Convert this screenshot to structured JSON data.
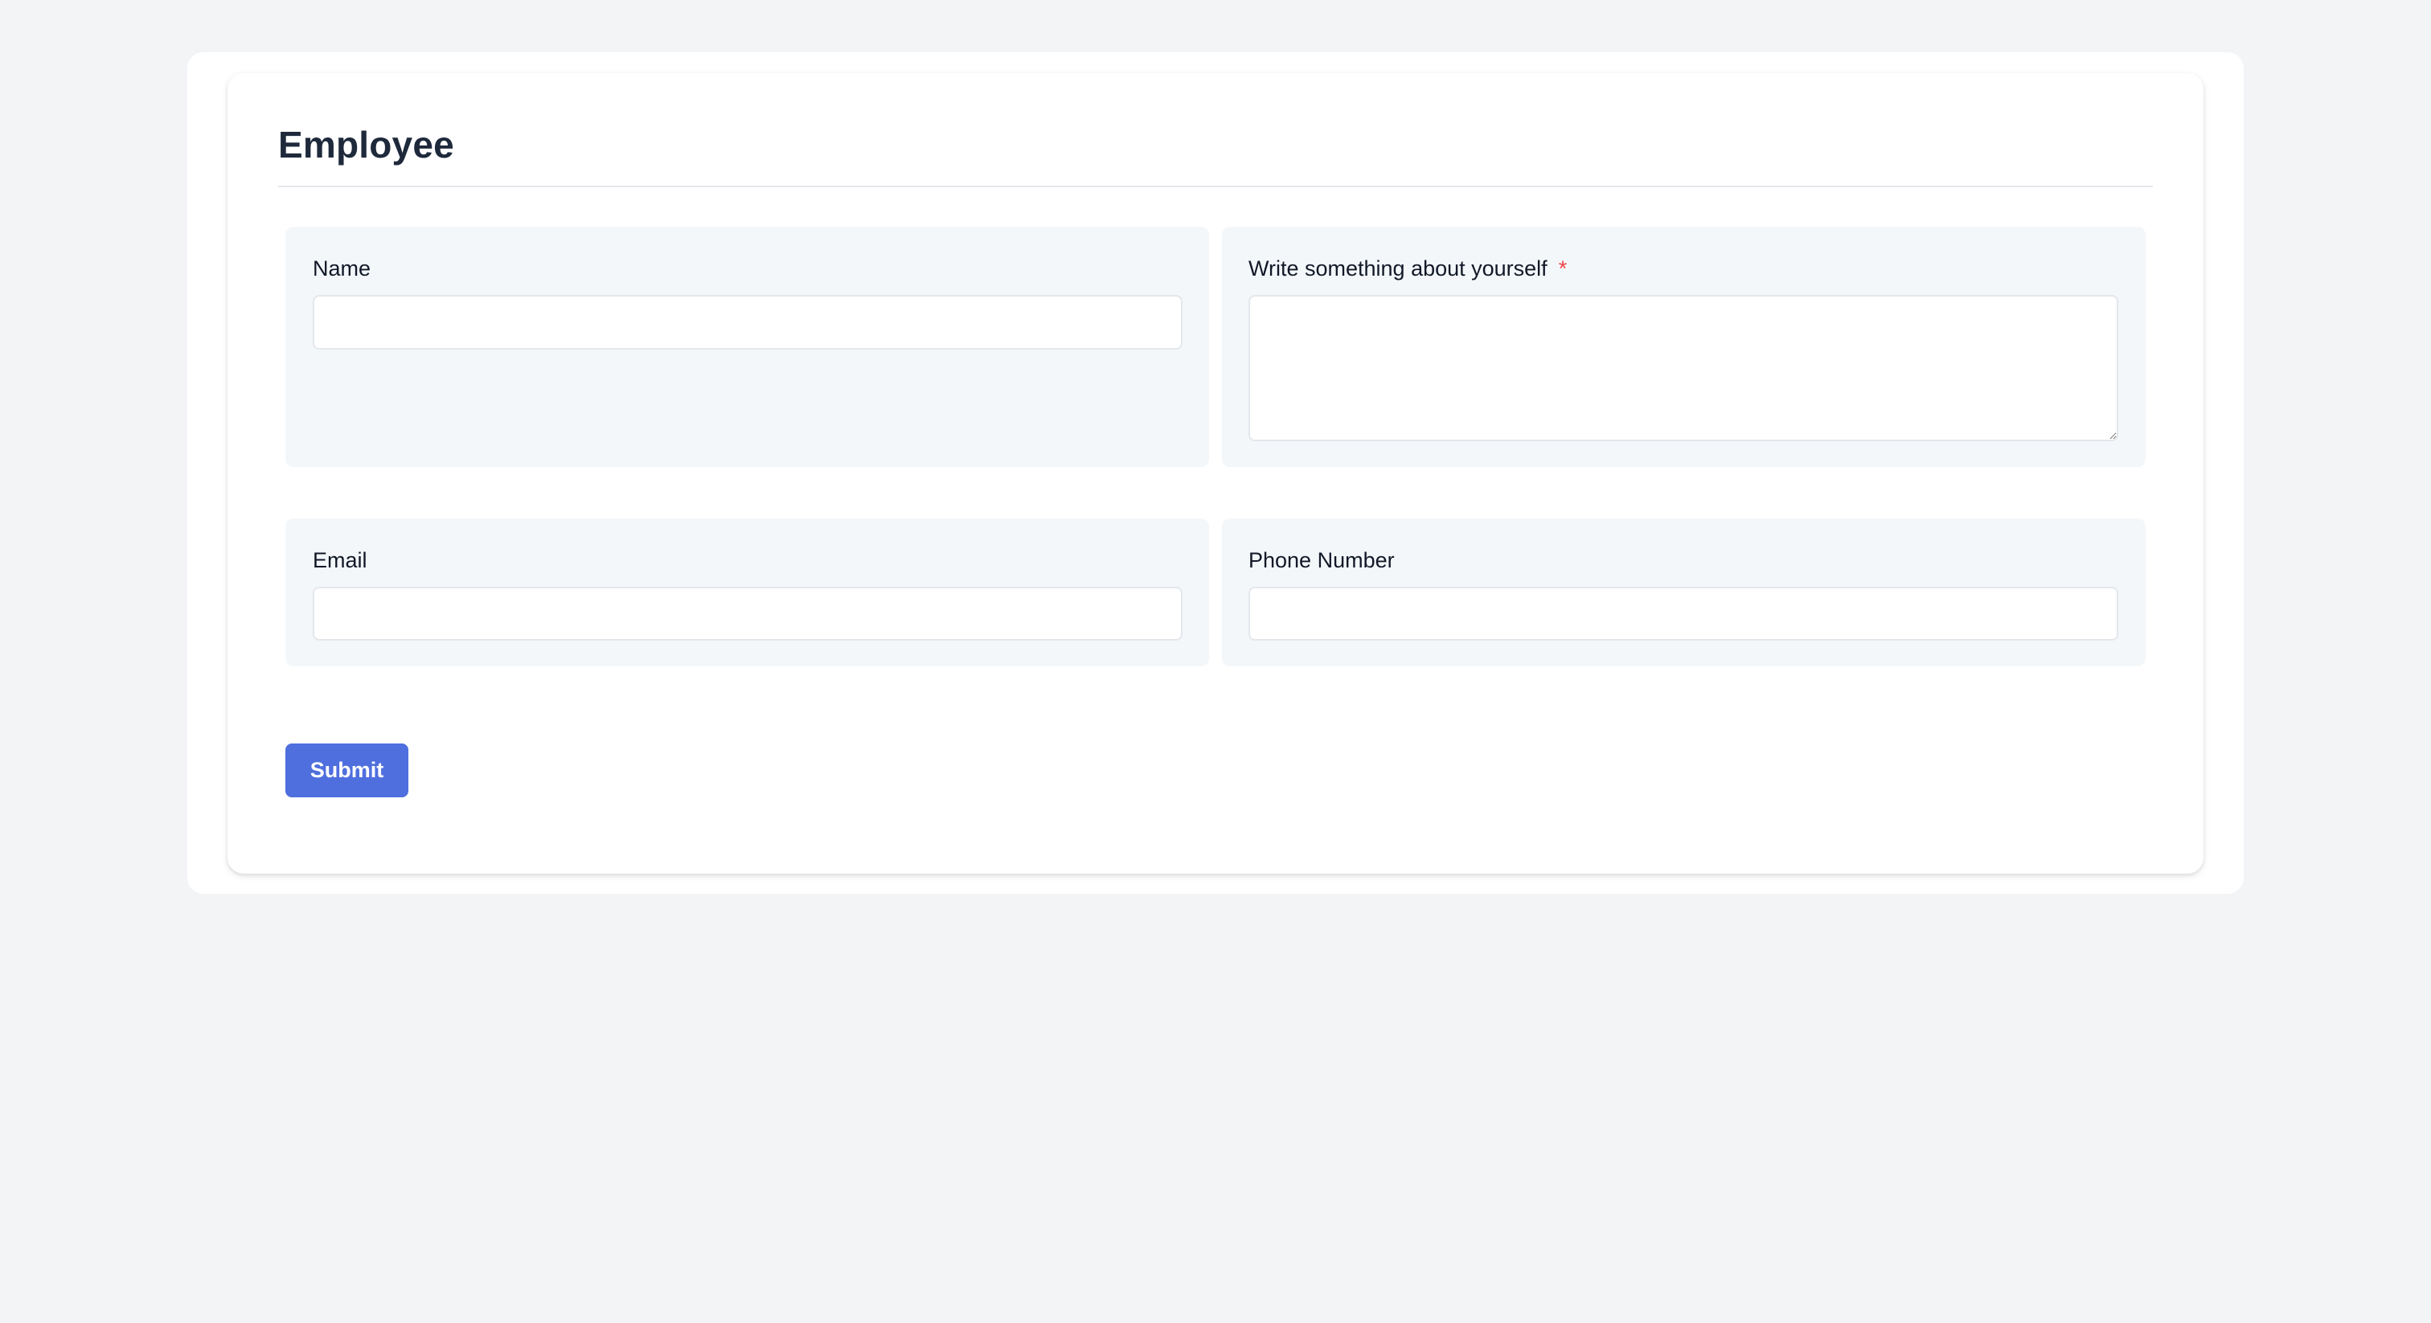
{
  "form": {
    "title": "Employee",
    "fields": {
      "name": {
        "label": "Name",
        "value": "",
        "placeholder": ""
      },
      "about": {
        "label": "Write something about yourself",
        "required_marker": "*",
        "value": "",
        "placeholder": ""
      },
      "email": {
        "label": "Email",
        "value": "",
        "placeholder": ""
      },
      "phone": {
        "label": "Phone Number",
        "value": "",
        "placeholder": ""
      }
    },
    "submit_label": "Submit"
  },
  "colors": {
    "page_background": "#f3f4f6",
    "card_background": "#ffffff",
    "field_background": "#f4f7fa",
    "title_text": "#1e293b",
    "required_marker": "#ef4444",
    "primary_button": "#4f6fde"
  }
}
